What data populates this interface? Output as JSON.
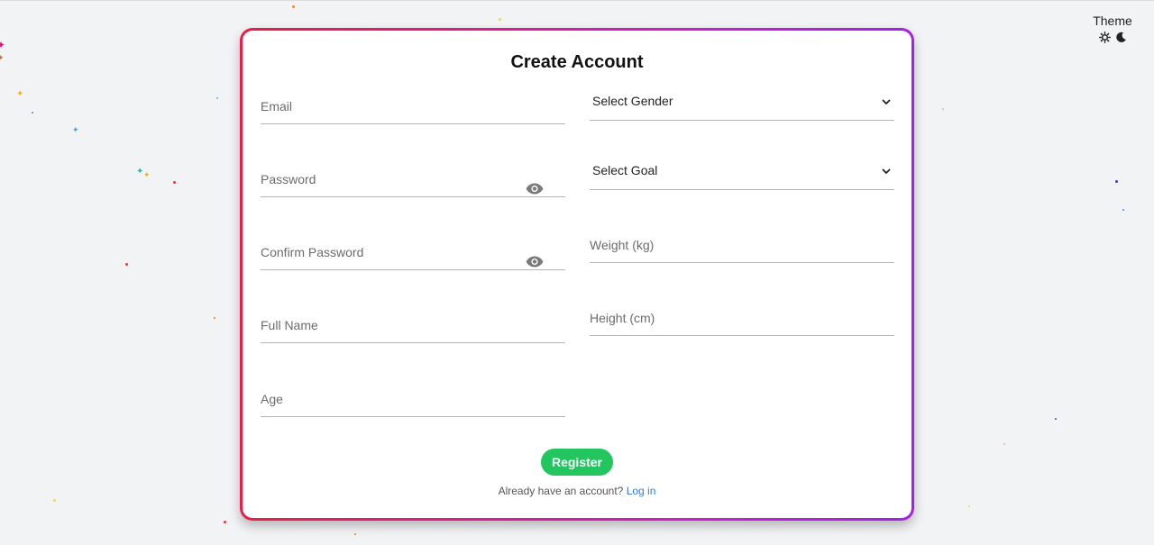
{
  "theme": {
    "title": "Theme",
    "light_icon": "sun-icon",
    "dark_icon": "moon-icon"
  },
  "form": {
    "title": "Create Account",
    "email_placeholder": "Email",
    "password_placeholder": "Password",
    "confirm_password_placeholder": "Confirm Password",
    "full_name_placeholder": "Full Name",
    "age_placeholder": "Age",
    "gender_select": "Select Gender",
    "goal_select": "Select Goal",
    "weight_placeholder": "Weight (kg)",
    "height_placeholder": "Height (cm)",
    "register_label": "Register",
    "login_prompt": "Already have an account?",
    "login_link": "Log in"
  },
  "colors": {
    "card_border_start": "#ec1d45",
    "card_border_end": "#a421e6",
    "register_button": "#22c55e",
    "link": "#2f7ae5",
    "page_background": "#f2f3f5"
  }
}
